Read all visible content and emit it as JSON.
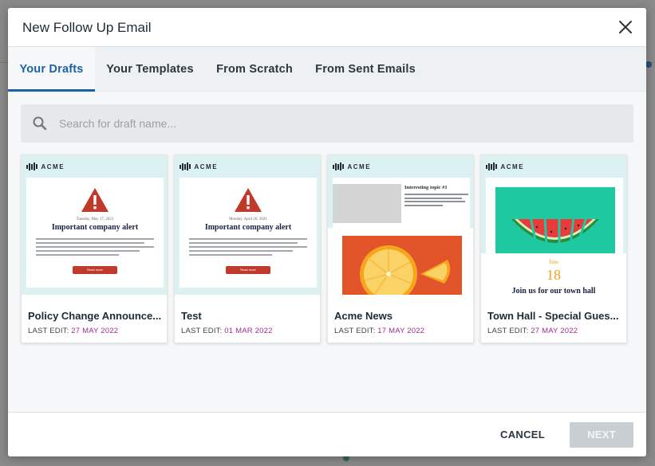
{
  "modal": {
    "title": "New Follow Up Email"
  },
  "tabs": [
    {
      "label": "Your Drafts",
      "active": true
    },
    {
      "label": "Your Templates",
      "active": false
    },
    {
      "label": "From Scratch",
      "active": false
    },
    {
      "label": "From Sent Emails",
      "active": false
    }
  ],
  "search": {
    "placeholder": "Search for draft name...",
    "icon": "search-icon"
  },
  "cards": [
    {
      "name": "Policy Change Announce...",
      "last_edit_label": "LAST EDIT:",
      "last_edit_date": "27 MAY 2022",
      "thumbnail": {
        "logo": "ACME",
        "date": "Tuesday, May 17, 2021",
        "heading": "Important company alert",
        "button": "Read more"
      }
    },
    {
      "name": "Test",
      "last_edit_label": "LAST EDIT:",
      "last_edit_date": "01 MAR 2022",
      "thumbnail": {
        "logo": "ACME",
        "date": "Monday, April 26, 2021",
        "heading": "Important company alert",
        "button": "Read more"
      }
    },
    {
      "name": "Acme News",
      "last_edit_label": "LAST EDIT:",
      "last_edit_date": "17 MAY 2022",
      "thumbnail": {
        "logo": "ACME",
        "topic": "Interesting topic #1"
      }
    },
    {
      "name": "Town Hall - Special Gues...",
      "last_edit_label": "LAST EDIT:",
      "last_edit_date": "27 MAY 2022",
      "thumbnail": {
        "logo": "ACME",
        "month": "June",
        "day": "18",
        "heading": "Join us for our town hall"
      }
    }
  ],
  "footer": {
    "cancel_label": "CANCEL",
    "next_label": "NEXT"
  },
  "colors": {
    "accent": "#1a62a8",
    "date_accent": "#9b2f8c",
    "disabled_button": "#c9ced3"
  }
}
